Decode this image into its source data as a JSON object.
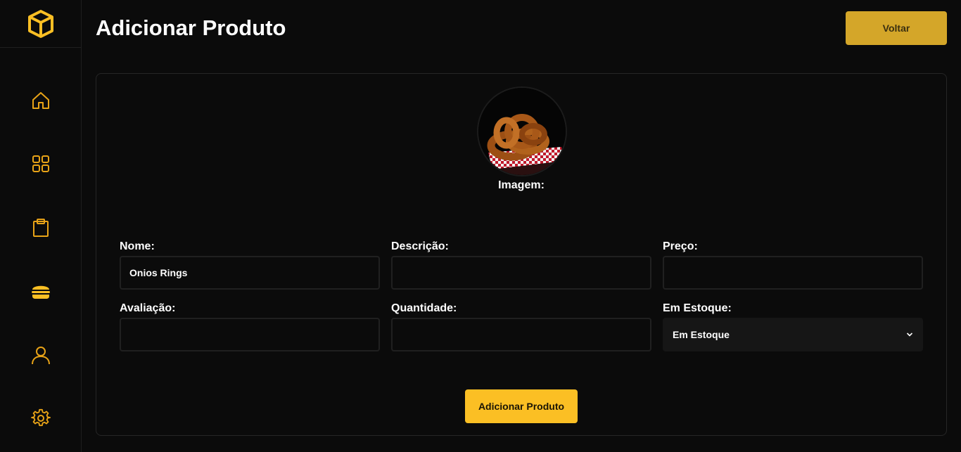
{
  "colors": {
    "accent": "#fbbf24",
    "icon": "#e8a317",
    "background": "#0b0b0b"
  },
  "sidebar": {
    "logo_icon": "box-icon",
    "items": [
      {
        "icon": "home-icon"
      },
      {
        "icon": "grid-icon"
      },
      {
        "icon": "clipboard-icon"
      },
      {
        "icon": "burger-icon"
      },
      {
        "icon": "user-icon"
      },
      {
        "icon": "gear-icon"
      }
    ]
  },
  "header": {
    "title": "Adicionar Produto",
    "back_label": "Voltar"
  },
  "form": {
    "image_label": "Imagem:",
    "name": {
      "label": "Nome:",
      "value": "Onios Rings"
    },
    "description": {
      "label": "Descrição:",
      "value": ""
    },
    "price": {
      "label": "Preço:",
      "value": ""
    },
    "rating": {
      "label": "Avaliação:",
      "value": ""
    },
    "quantity": {
      "label": "Quantidade:",
      "value": ""
    },
    "stock": {
      "label": "Em Estoque:",
      "selected": "Em Estoque"
    },
    "submit_label": "Adicionar Produto"
  }
}
